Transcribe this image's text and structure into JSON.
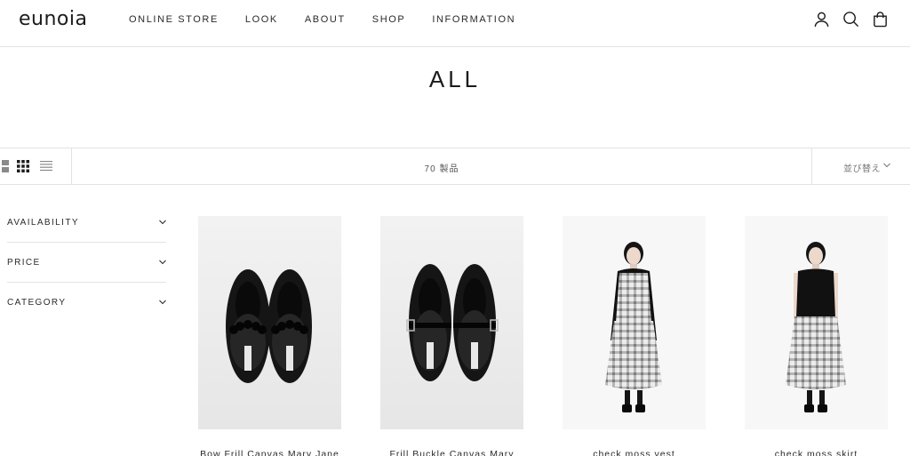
{
  "header": {
    "logo": "eunoia",
    "nav": [
      "ONLINE STORE",
      "LOOK",
      "ABOUT",
      "SHOP",
      "INFORMATION"
    ],
    "icons": [
      "account-icon",
      "search-icon",
      "cart-icon"
    ]
  },
  "page_title": "ALL",
  "toolbar": {
    "view_icons": [
      "grid-large-icon",
      "grid-small-icon",
      "list-icon"
    ],
    "product_count": "70 製品",
    "sort_label": "並び替え"
  },
  "filters": [
    {
      "label": "AVAILABILITY"
    },
    {
      "label": "PRICE"
    },
    {
      "label": "CATEGORY"
    }
  ],
  "products": [
    {
      "name": "Bow Frill Canvas Mary Jane"
    },
    {
      "name": "Frill Buckle Canvas Mary"
    },
    {
      "name": "check moss vest"
    },
    {
      "name": "check moss skirt"
    }
  ]
}
